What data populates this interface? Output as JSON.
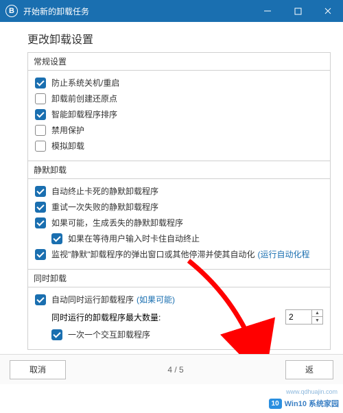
{
  "window": {
    "title": "开始新的卸载任务"
  },
  "page_title": "更改卸载设置",
  "groups": {
    "general": {
      "header": "常规设置",
      "items": [
        {
          "label": "防止系统关机/重启",
          "checked": true
        },
        {
          "label": "卸载前创建还原点",
          "checked": false
        },
        {
          "label": "智能卸载程序排序",
          "checked": true
        },
        {
          "label": "禁用保护",
          "checked": false
        },
        {
          "label": "模拟卸载",
          "checked": false
        }
      ]
    },
    "silent": {
      "header": "静默卸载",
      "items": [
        {
          "label": "自动终止卡死的静默卸载程序",
          "checked": true
        },
        {
          "label": "重试一次失败的静默卸载程序",
          "checked": true
        },
        {
          "label": "如果可能，生成丢失的静默卸载程序",
          "checked": true
        },
        {
          "label": "如果在等待用户输入时卡住自动终止",
          "checked": true,
          "indent": true
        },
        {
          "label": "监视\"静默\"卸载程序的弹出窗口或其他停滞并使其自动化",
          "checked": true,
          "hint": "(运行自动化程"
        }
      ]
    },
    "concurrent": {
      "header": "同时卸载",
      "main": {
        "label": "自动同时运行卸载程序",
        "checked": true,
        "hint": "(如果可能)"
      },
      "count_label": "同时运行的卸载程序最大数量:",
      "count_value": "2",
      "sub": {
        "label": "一次一个交互卸载程序",
        "checked": true
      }
    }
  },
  "footer": {
    "cancel": "取消",
    "pager": "4 / 5",
    "back": "返"
  },
  "watermark": {
    "badge": "10",
    "text": "Win10 系统家园",
    "url": "www.qdhuajin.com"
  }
}
